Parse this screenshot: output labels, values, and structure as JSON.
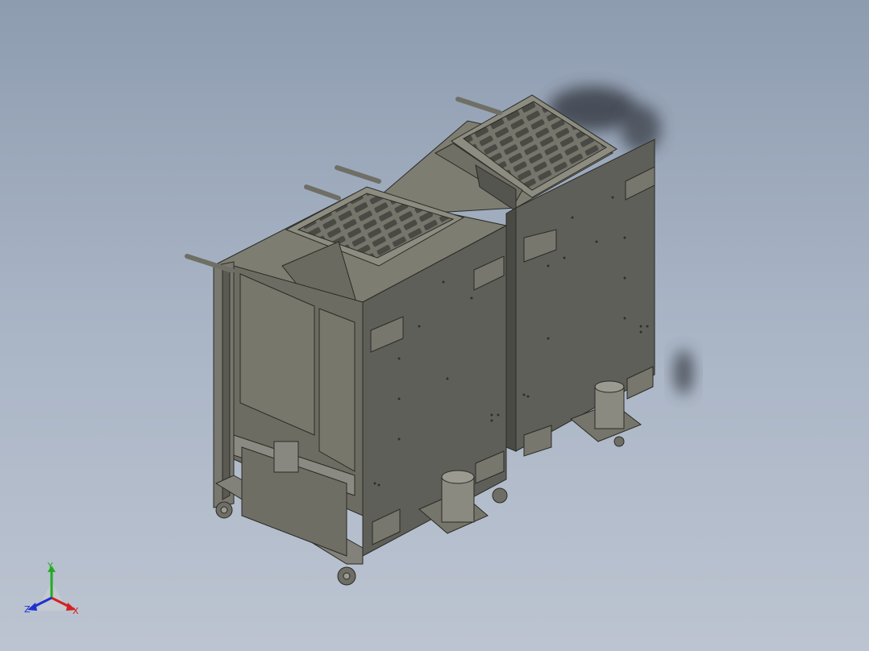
{
  "viewport": {
    "background_top": "#8e9cb0",
    "background_bottom": "#bcc4d1",
    "model_color": "#5f5f59",
    "model_light": "#8a8a7e",
    "model_edge": "#2b2b26"
  },
  "triad": {
    "x_label": "X",
    "y_label": "Y",
    "z_label": "Z",
    "x_color": "#d42020",
    "y_color": "#22aa22",
    "z_color": "#2030d0",
    "icon": "coordinate-triad-icon"
  }
}
